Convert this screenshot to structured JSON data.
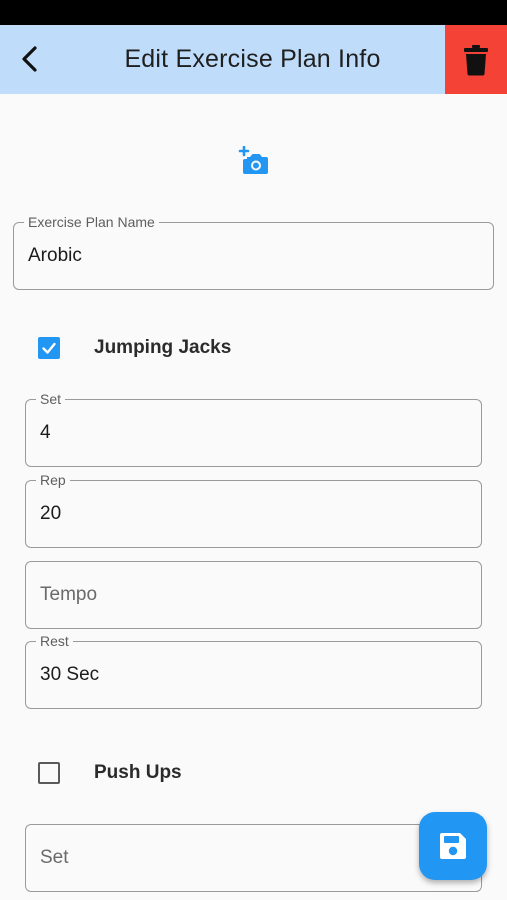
{
  "app_bar": {
    "title": "Edit Exercise Plan Info",
    "back_icon": "arrow-back-ios-icon",
    "delete_icon": "trash-icon",
    "delete_color": "#f44336",
    "background_color": "#bfdcfa"
  },
  "photo": {
    "icon": "add-a-photo-icon",
    "color": "#2196f3"
  },
  "plan_name": {
    "label": "Exercise Plan Name",
    "value": "Arobic"
  },
  "exercises": [
    {
      "name": "Jumping Jacks",
      "checked": true,
      "set": {
        "label": "Set",
        "value": "4"
      },
      "rep": {
        "label": "Rep",
        "value": "20"
      },
      "tempo": {
        "placeholder": "Tempo"
      },
      "rest": {
        "label": "Rest",
        "value": "30 Sec"
      }
    },
    {
      "name": "Push Ups",
      "checked": false,
      "set": {
        "placeholder": "Set"
      }
    }
  ],
  "fab": {
    "icon": "save-icon",
    "color": "#2196f3"
  }
}
